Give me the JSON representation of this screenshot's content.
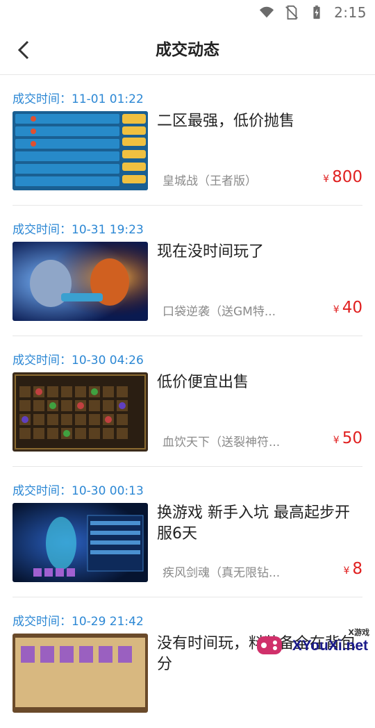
{
  "status_bar": {
    "time": "2:15"
  },
  "header": {
    "title": "成交动态"
  },
  "items": [
    {
      "time": "成交时间：11-01 01:22",
      "title": "二区最强，低价抛售",
      "game": "皇城战（王者版）",
      "price_symbol": "¥",
      "price": "800",
      "thumb_theme": "leaderboard"
    },
    {
      "time": "成交时间：10-31 19:23",
      "title": "现在没时间玩了",
      "game": "口袋逆袭（送GM特...",
      "price_symbol": "¥",
      "price": "40",
      "thumb_theme": "monster-battle"
    },
    {
      "time": "成交时间：10-30 04:26",
      "title": "低价便宜出售",
      "game": "血饮天下（送裂神符...",
      "price_symbol": "¥",
      "price": "50",
      "thumb_theme": "inventory"
    },
    {
      "time": "成交时间：10-30 00:13",
      "title": "换游戏 新手入坑 最高起步开服6天",
      "game": "疾风剑魂（真无限钻...",
      "price_symbol": "¥",
      "price": "8",
      "thumb_theme": "character"
    },
    {
      "time": "成交时间：10-29 21:42",
      "title": "没有时间玩，料装备全在背包分",
      "game": "",
      "price_symbol": "",
      "price": "",
      "thumb_theme": "cards"
    }
  ],
  "watermark": {
    "text": "XYouXi.net",
    "small": "X游戏"
  },
  "colors": {
    "accent": "#2b87d4",
    "price": "#e02020"
  }
}
